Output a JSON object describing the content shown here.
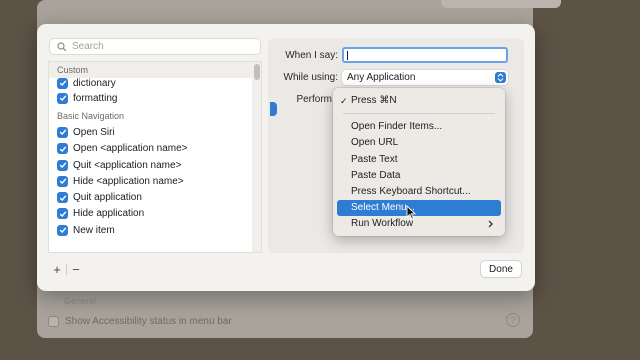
{
  "background": {
    "section_label": "General",
    "checkbox_label": "Show Accessibility status in menu bar",
    "help": "?"
  },
  "search": {
    "placeholder": "Search"
  },
  "list": {
    "sections": [
      {
        "header": "Custom",
        "items": [
          "dictionary",
          "formatting"
        ]
      },
      {
        "header": "Basic Navigation",
        "items": [
          "Open Siri",
          "Open <application name>",
          "Quit <application name>",
          "Hide <application name>",
          "Quit application",
          "Hide application",
          "New item"
        ]
      }
    ]
  },
  "footer": {
    "add": "+",
    "remove": "−",
    "done": "Done"
  },
  "form": {
    "when_label": "When I say:",
    "when_value": "",
    "while_label": "While using:",
    "while_value": "Any Application",
    "perform_label": "Perform"
  },
  "menu": {
    "checked_item": "Press ⌘N",
    "items": [
      "Open Finder Items...",
      "Open URL",
      "Paste Text",
      "Paste Data",
      "Press Keyboard Shortcut...",
      "Select Menu...",
      "Run Workflow"
    ],
    "selected_index": 5,
    "submenu_index": 6
  },
  "colors": {
    "accent": "#2f7cd4",
    "focus_ring": "#6aa3e8"
  }
}
